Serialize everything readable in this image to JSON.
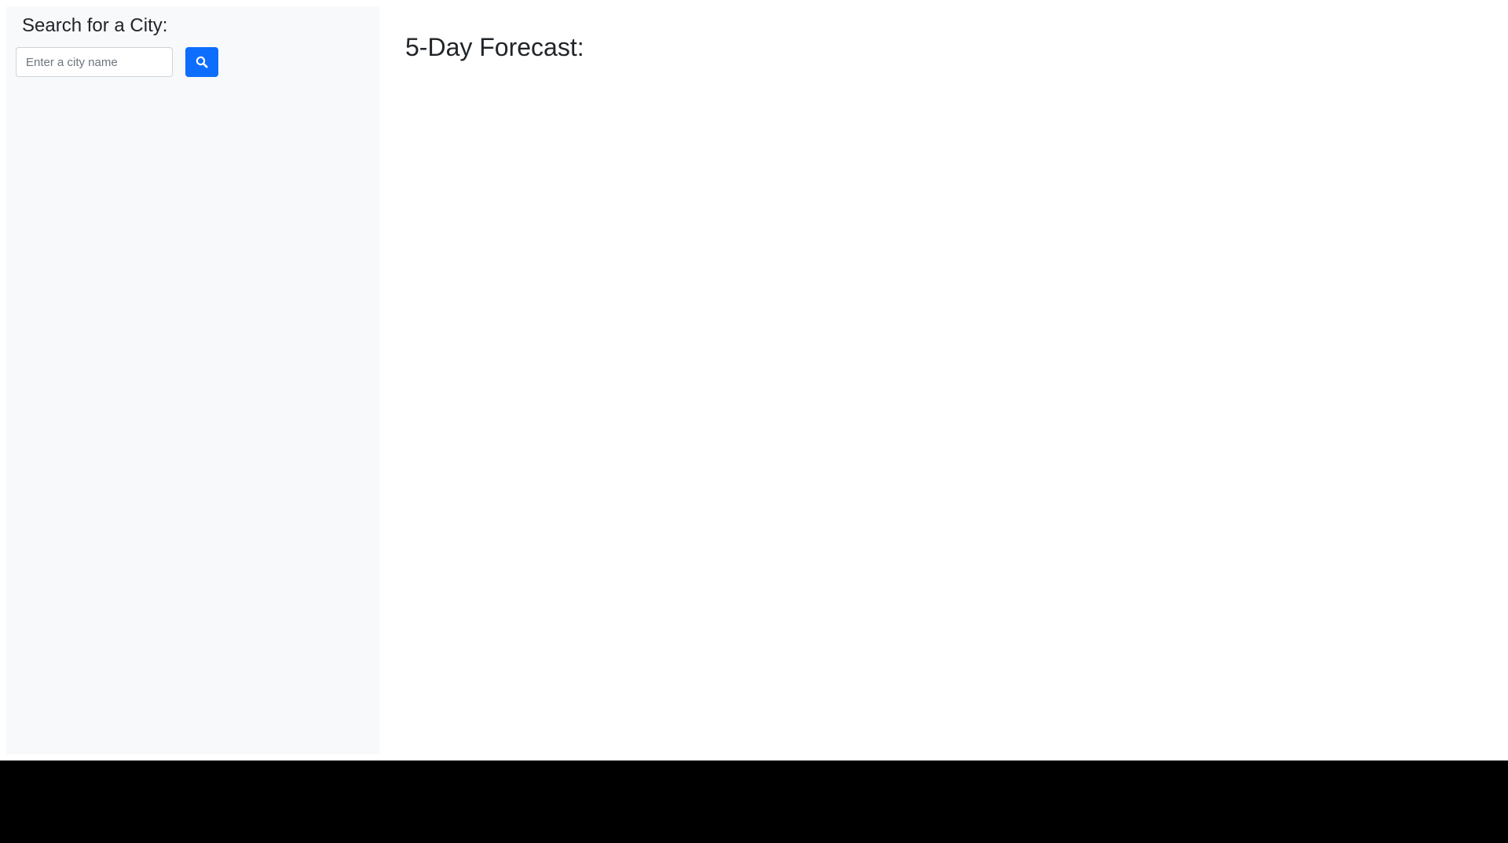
{
  "sidebar": {
    "title": "Search for a City:",
    "search": {
      "placeholder": "Enter a city name",
      "value": "",
      "button_icon": "search-icon"
    }
  },
  "main": {
    "forecast_title": "5-Day Forecast:"
  },
  "colors": {
    "accent": "#0d6efd",
    "sidebar_bg": "#f8f9fa",
    "text": "#212529"
  }
}
